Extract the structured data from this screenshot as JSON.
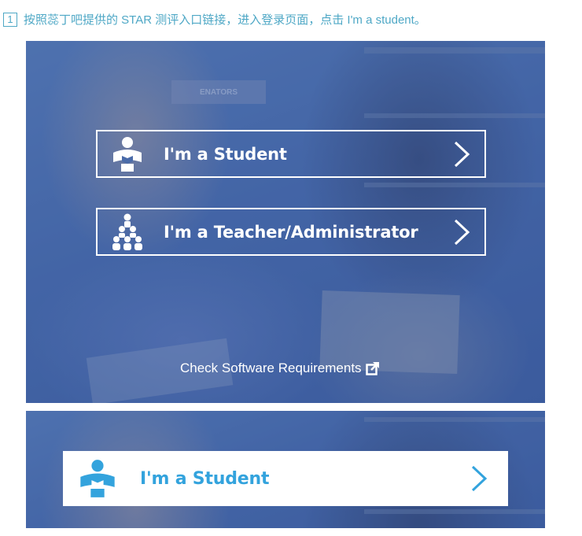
{
  "instruction": {
    "step_number": "1",
    "text": "按照蕊丁吧提供的 STAR 测评入口链接，进入登录页面，点击 I'm a student。"
  },
  "login_panel": {
    "student_button_label": "I'm a Student",
    "teacher_button_label": "I'm a Teacher/Administrator",
    "requirements_link": "Check Software Requirements",
    "background_sign_text": "ENATORS"
  },
  "highlight_panel": {
    "student_button_label": "I'm a Student"
  },
  "icons": {
    "student": "student-reading-icon",
    "teacher": "group-icon",
    "chevron": "chevron-right-icon",
    "external": "external-link-icon"
  },
  "colors": {
    "instruction": "#4fa8c6",
    "panel_blue": "#4a6ba9",
    "highlight_blue": "#33a3dd",
    "white": "#ffffff"
  }
}
